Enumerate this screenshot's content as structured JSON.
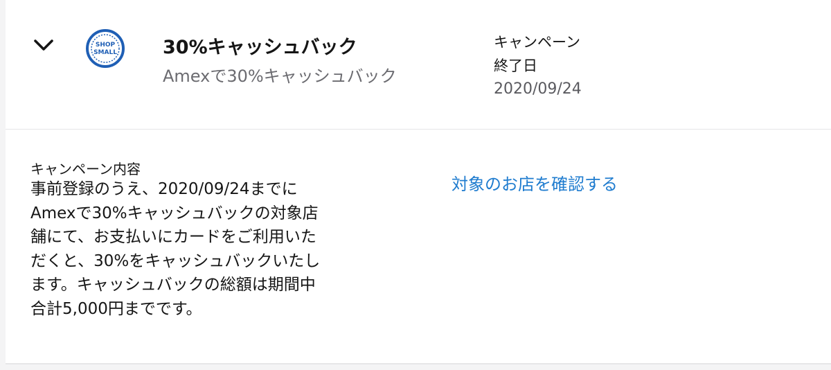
{
  "offer": {
    "logo_text_line1": "SHOP",
    "logo_text_line2": "SMALL",
    "title": "30%キャッシュバック",
    "subtitle": "Amexで30%キャッシュバック",
    "end_label_line1": "キャンペーン",
    "end_label_line2": "終了日",
    "end_date": "2020/09/24"
  },
  "details": {
    "label": "キャンペーン内容",
    "lines": [
      "事前登録のうえ、2020/09/24までに",
      "Amexで30%キャッシュバックの対象店",
      "舗にて、お支払いにカードをご利用いた",
      "だくと、30%をキャッシュバックいたし",
      "ます。キャッシュバックの総額は期間中",
      "合計5,000円までです。"
    ],
    "link_text": "対象のお店を確認する"
  },
  "colors": {
    "link": "#1f7ccf",
    "logo_blue": "#1f5fb5",
    "subtitle_gray": "#6b6b70"
  },
  "icons": {
    "expand": "chevron-down-icon",
    "brand": "shop-small-logo"
  }
}
